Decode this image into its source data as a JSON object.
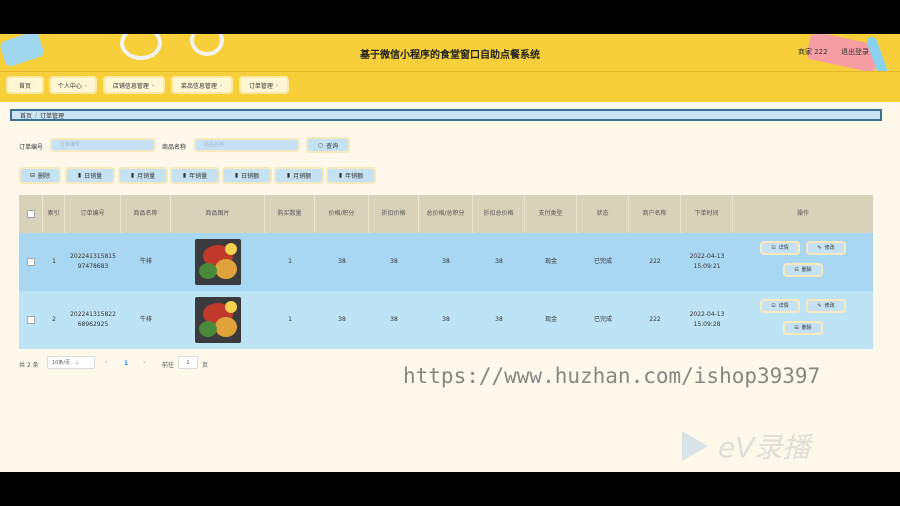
{
  "header": {
    "title": "基于微信小程序的食堂窗口自助点餐系统",
    "merchant": "商家 222",
    "logout": "退出登录"
  },
  "nav": {
    "items": [
      {
        "label": "首页",
        "has_dropdown": false
      },
      {
        "label": "个人中心",
        "has_dropdown": true
      },
      {
        "label": "店铺信息管理",
        "has_dropdown": true
      },
      {
        "label": "菜品信息管理",
        "has_dropdown": true
      },
      {
        "label": "订单管理",
        "has_dropdown": true
      }
    ]
  },
  "breadcrumb": {
    "home": "首页",
    "current": "订单管理"
  },
  "search": {
    "order_no_label": "订单编号",
    "order_no_placeholder": "订单编号",
    "product_label": "商品名称",
    "product_placeholder": "商品名称",
    "query_button": "查询"
  },
  "actions": {
    "delete": "删除",
    "daily_sales": "日销量",
    "monthly_sales": "月销量",
    "yearly_sales": "年销量",
    "daily_revenue": "日销额",
    "monthly_revenue": "月销额",
    "yearly_revenue": "年销额"
  },
  "table": {
    "headers": [
      "索引",
      "订单编号",
      "商品名称",
      "商品图片",
      "购买数量",
      "价格/积分",
      "折扣价格",
      "总价格/总积分",
      "折扣总价格",
      "支付类型",
      "状态",
      "商户名称",
      "下单时间",
      "操作"
    ],
    "rows": [
      {
        "index": "1",
        "order_no": "20224131581597478683",
        "product": "牛排",
        "quantity": "1",
        "price": "38",
        "discount_price": "38",
        "total": "38",
        "discount_total": "38",
        "pay_type": "现金",
        "status": "已完成",
        "merchant": "222",
        "time": "2022-04-13 15:09:21"
      },
      {
        "index": "2",
        "order_no": "20224131582268962925",
        "product": "牛排",
        "quantity": "1",
        "price": "38",
        "discount_price": "38",
        "total": "38",
        "discount_total": "38",
        "pay_type": "现金",
        "status": "已完成",
        "merchant": "222",
        "time": "2022-04-13 15:09:28"
      }
    ],
    "row_actions": {
      "detail": "详情",
      "edit": "修改",
      "delete": "删除"
    }
  },
  "pagination": {
    "total": "共 2 条",
    "page_size": "10条/页",
    "current_page": "1",
    "goto_label": "前往",
    "goto_value": "1",
    "page_unit": "页"
  },
  "watermark": {
    "url": "https://www.huzhan.com/ishop39397",
    "brand": "eV录播"
  },
  "colors": {
    "header": "#f7cf3a",
    "row_1": "#a9d6f0",
    "row_2": "#bde3f5",
    "breadcrumb_border": "#3e6f8e"
  }
}
